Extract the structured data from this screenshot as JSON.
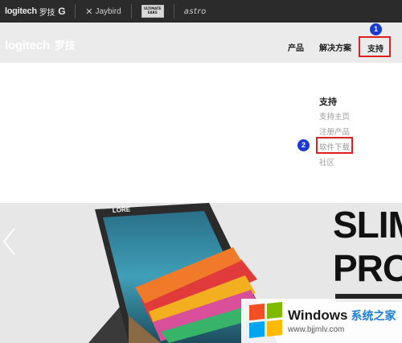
{
  "brandbar": {
    "logitech_text": "logitech",
    "logitech_cn": "罗技",
    "logitech_g": "G",
    "jaybird": "Jaybird",
    "ultimate_ears_line1": "ULTIMATE",
    "ultimate_ears_line2": "EARS",
    "astro": "astro"
  },
  "navbar": {
    "logo_text": "logitech",
    "logo_cn": "罗技",
    "items": [
      {
        "label": "产品"
      },
      {
        "label": "解决方案"
      },
      {
        "label": "支持"
      }
    ]
  },
  "dropdown": {
    "title": "支持",
    "items": [
      {
        "label": "支持主页"
      },
      {
        "label": "注册产品"
      },
      {
        "label": "软件下载"
      },
      {
        "label": "社区"
      }
    ]
  },
  "markers": {
    "one": "1",
    "two": "2"
  },
  "hero": {
    "line1": "SLIM",
    "line2": "PRO",
    "tablet_brand": "LORE"
  },
  "watermark": {
    "title": "Windows",
    "title_cn": "系统之家",
    "url": "www.bjjmlv.com"
  },
  "colors": {
    "brandbar_bg": "#2b2b2b",
    "navbar_bg": "#ebebeb",
    "highlight": "#e02020",
    "marker": "#1a3ad0"
  }
}
